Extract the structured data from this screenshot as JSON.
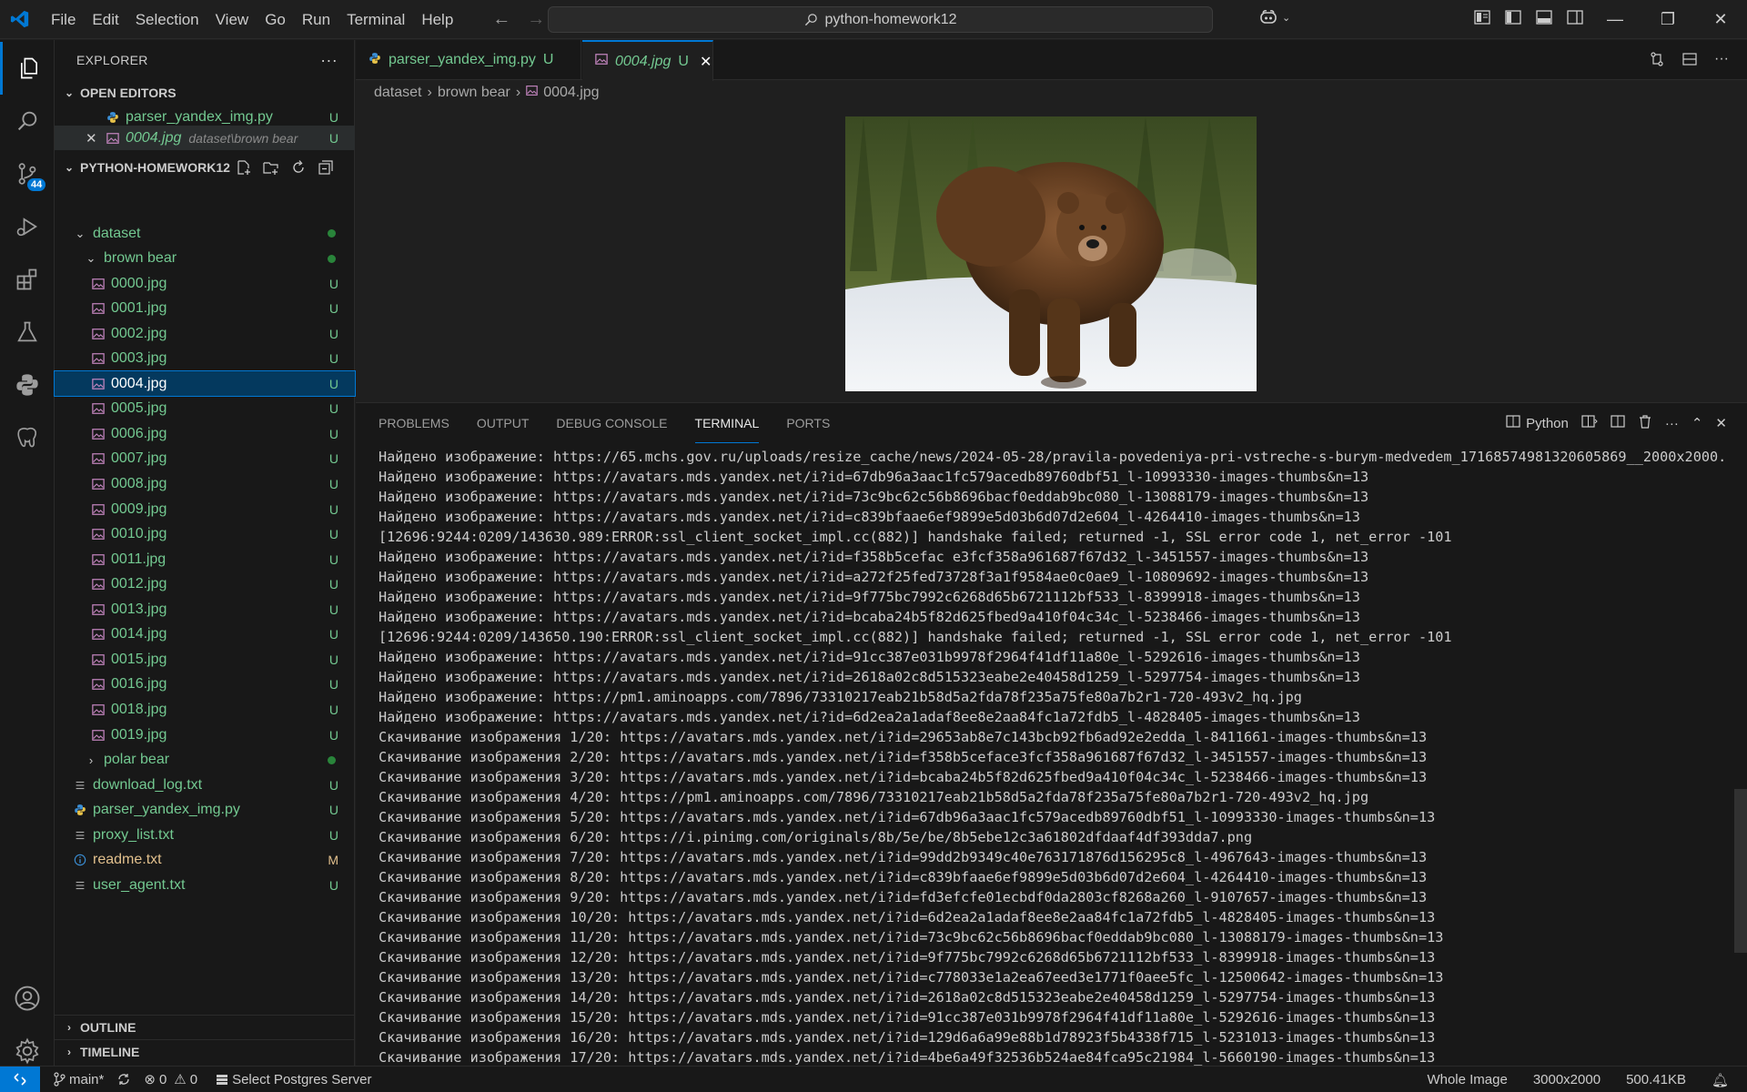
{
  "titlebar": {
    "menu": [
      "File",
      "Edit",
      "Selection",
      "View",
      "Go",
      "Run",
      "Terminal",
      "Help"
    ],
    "search": "python-homework12"
  },
  "activity": {
    "scm_badge": "44"
  },
  "sidebar": {
    "title": "EXPLORER",
    "open_editors_label": "OPEN EDITORS",
    "open_editors": [
      {
        "name": "parser_yandex_img.py",
        "status": "U",
        "desc": ""
      },
      {
        "name": "0004.jpg",
        "status": "U",
        "desc": "dataset\\brown bear"
      }
    ],
    "project_label": "PYTHON-HOMEWORK12",
    "tree": [
      {
        "name": "dataset",
        "type": "folder-open",
        "status": "dot",
        "indent": 1
      },
      {
        "name": "brown bear",
        "type": "folder-open",
        "status": "dot",
        "indent": 2
      },
      {
        "name": "0000.jpg",
        "type": "img",
        "status": "U",
        "indent": 3
      },
      {
        "name": "0001.jpg",
        "type": "img",
        "status": "U",
        "indent": 3
      },
      {
        "name": "0002.jpg",
        "type": "img",
        "status": "U",
        "indent": 3
      },
      {
        "name": "0003.jpg",
        "type": "img",
        "status": "U",
        "indent": 3
      },
      {
        "name": "0004.jpg",
        "type": "img",
        "status": "U",
        "indent": 3,
        "selected": true
      },
      {
        "name": "0005.jpg",
        "type": "img",
        "status": "U",
        "indent": 3
      },
      {
        "name": "0006.jpg",
        "type": "img",
        "status": "U",
        "indent": 3
      },
      {
        "name": "0007.jpg",
        "type": "img",
        "status": "U",
        "indent": 3
      },
      {
        "name": "0008.jpg",
        "type": "img",
        "status": "U",
        "indent": 3
      },
      {
        "name": "0009.jpg",
        "type": "img",
        "status": "U",
        "indent": 3
      },
      {
        "name": "0010.jpg",
        "type": "img",
        "status": "U",
        "indent": 3
      },
      {
        "name": "0011.jpg",
        "type": "img",
        "status": "U",
        "indent": 3
      },
      {
        "name": "0012.jpg",
        "type": "img",
        "status": "U",
        "indent": 3
      },
      {
        "name": "0013.jpg",
        "type": "img",
        "status": "U",
        "indent": 3
      },
      {
        "name": "0014.jpg",
        "type": "img",
        "status": "U",
        "indent": 3
      },
      {
        "name": "0015.jpg",
        "type": "img",
        "status": "U",
        "indent": 3
      },
      {
        "name": "0016.jpg",
        "type": "img",
        "status": "U",
        "indent": 3
      },
      {
        "name": "0018.jpg",
        "type": "img",
        "status": "U",
        "indent": 3
      },
      {
        "name": "0019.jpg",
        "type": "img",
        "status": "U",
        "indent": 3
      },
      {
        "name": "polar bear",
        "type": "folder-closed",
        "status": "dot",
        "indent": 2
      },
      {
        "name": "download_log.txt",
        "type": "txt",
        "status": "U",
        "indent": 1
      },
      {
        "name": "parser_yandex_img.py",
        "type": "py",
        "status": "U",
        "indent": 1
      },
      {
        "name": "proxy_list.txt",
        "type": "txt",
        "status": "U",
        "indent": 1
      },
      {
        "name": "readme.txt",
        "type": "info",
        "status": "M",
        "indent": 1
      },
      {
        "name": "user_agent.txt",
        "type": "txt",
        "status": "U",
        "indent": 1
      }
    ],
    "outline_label": "OUTLINE",
    "timeline_label": "TIMELINE"
  },
  "tabs": [
    {
      "name": "parser_yandex_img.py",
      "status": "U"
    },
    {
      "name": "0004.jpg",
      "status": "U"
    }
  ],
  "breadcrumb": [
    "dataset",
    "brown bear",
    "0004.jpg"
  ],
  "panel": {
    "tabs": [
      "PROBLEMS",
      "OUTPUT",
      "DEBUG CONSOLE",
      "TERMINAL",
      "PORTS"
    ],
    "active": "TERMINAL",
    "shell": "Python"
  },
  "terminal": [
    "Найдено изображение: https://65.mchs.gov.ru/uploads/resize_cache/news/2024-05-28/pravila-povedeniya-pri-vstreche-s-burym-medvedem_17168574981320605869__2000x2000.jpg",
    "Найдено изображение: https://avatars.mds.yandex.net/i?id=67db96a3aac1fc579acedb89760dbf51_l-10993330-images-thumbs&n=13",
    "Найдено изображение: https://avatars.mds.yandex.net/i?id=73c9bc62c56b8696bacf0eddab9bc080_l-13088179-images-thumbs&n=13",
    "Найдено изображение: https://avatars.mds.yandex.net/i?id=c839bfaae6ef9899e5d03b6d07d2e604_l-4264410-images-thumbs&n=13",
    "[12696:9244:0209/143630.989:ERROR:ssl_client_socket_impl.cc(882)] handshake failed; returned -1, SSL error code 1, net_error -101",
    "Найдено изображение: https://avatars.mds.yandex.net/i?id=f358b5cefac e3fcf358a961687f67d32_l-3451557-images-thumbs&n=13",
    "Найдено изображение: https://avatars.mds.yandex.net/i?id=a272f25fed73728f3a1f9584ae0c0ae9_l-10809692-images-thumbs&n=13",
    "Найдено изображение: https://avatars.mds.yandex.net/i?id=9f775bc7992c6268d65b6721112bf533_l-8399918-images-thumbs&n=13",
    "Найдено изображение: https://avatars.mds.yandex.net/i?id=bcaba24b5f82d625fbed9a410f04c34c_l-5238466-images-thumbs&n=13",
    "[12696:9244:0209/143650.190:ERROR:ssl_client_socket_impl.cc(882)] handshake failed; returned -1, SSL error code 1, net_error -101",
    "Найдено изображение: https://avatars.mds.yandex.net/i?id=91cc387e031b9978f2964f41df11a80e_l-5292616-images-thumbs&n=13",
    "Найдено изображение: https://avatars.mds.yandex.net/i?id=2618a02c8d515323eabe2e40458d1259_l-5297754-images-thumbs&n=13",
    "Найдено изображение: https://pm1.aminoapps.com/7896/73310217eab21b58d5a2fda78f235a75fe80a7b2r1-720-493v2_hq.jpg",
    "Найдено изображение: https://avatars.mds.yandex.net/i?id=6d2ea2a1adaf8ee8e2aa84fc1a72fdb5_l-4828405-images-thumbs&n=13",
    "Скачивание изображения 1/20: https://avatars.mds.yandex.net/i?id=29653ab8e7c143bcb92fb6ad92e2edda_l-8411661-images-thumbs&n=13",
    "Скачивание изображения 2/20: https://avatars.mds.yandex.net/i?id=f358b5ceface3fcf358a961687f67d32_l-3451557-images-thumbs&n=13",
    "Скачивание изображения 3/20: https://avatars.mds.yandex.net/i?id=bcaba24b5f82d625fbed9a410f04c34c_l-5238466-images-thumbs&n=13",
    "Скачивание изображения 4/20: https://pm1.aminoapps.com/7896/73310217eab21b58d5a2fda78f235a75fe80a7b2r1-720-493v2_hq.jpg",
    "Скачивание изображения 5/20: https://avatars.mds.yandex.net/i?id=67db96a3aac1fc579acedb89760dbf51_l-10993330-images-thumbs&n=13",
    "Скачивание изображения 6/20: https://i.pinimg.com/originals/8b/5e/be/8b5ebe12c3a61802dfdaaf4df393dda7.png",
    "Скачивание изображения 7/20: https://avatars.mds.yandex.net/i?id=99dd2b9349c40e763171876d156295c8_l-4967643-images-thumbs&n=13",
    "Скачивание изображения 8/20: https://avatars.mds.yandex.net/i?id=c839bfaae6ef9899e5d03b6d07d2e604_l-4264410-images-thumbs&n=13",
    "Скачивание изображения 9/20: https://avatars.mds.yandex.net/i?id=fd3efcfe01ecbdf0da2803cf8268a260_l-9107657-images-thumbs&n=13",
    "Скачивание изображения 10/20: https://avatars.mds.yandex.net/i?id=6d2ea2a1adaf8ee8e2aa84fc1a72fdb5_l-4828405-images-thumbs&n=13",
    "Скачивание изображения 11/20: https://avatars.mds.yandex.net/i?id=73c9bc62c56b8696bacf0eddab9bc080_l-13088179-images-thumbs&n=13",
    "Скачивание изображения 12/20: https://avatars.mds.yandex.net/i?id=9f775bc7992c6268d65b6721112bf533_l-8399918-images-thumbs&n=13",
    "Скачивание изображения 13/20: https://avatars.mds.yandex.net/i?id=c778033e1a2ea67eed3e1771f0aee5fc_l-12500642-images-thumbs&n=13",
    "Скачивание изображения 14/20: https://avatars.mds.yandex.net/i?id=2618a02c8d515323eabe2e40458d1259_l-5297754-images-thumbs&n=13",
    "Скачивание изображения 15/20: https://avatars.mds.yandex.net/i?id=91cc387e031b9978f2964f41df11a80e_l-5292616-images-thumbs&n=13",
    "Скачивание изображения 16/20: https://avatars.mds.yandex.net/i?id=129d6a6a99e88b1d78923f5b4338f715_l-5231013-images-thumbs&n=13",
    "Скачивание изображения 17/20: https://avatars.mds.yandex.net/i?id=4be6a49f32536b524ae84fca95c21984_l-5660190-images-thumbs&n=13"
  ],
  "statusbar": {
    "branch": "main*",
    "errors": "0",
    "warnings": "0",
    "postgres": "Select Postgres Server",
    "zoom": "Whole Image",
    "dimensions": "3000x2000",
    "size": "500.41KB"
  },
  "colors": {
    "accent": "#0078d4",
    "untracked": "#73c991",
    "modified": "#e2c08d"
  }
}
